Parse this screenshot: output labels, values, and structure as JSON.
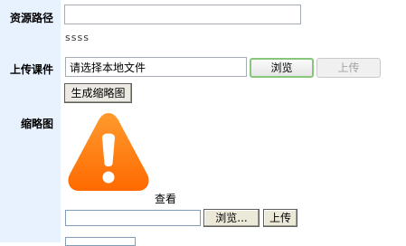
{
  "form": {
    "resource_path": {
      "label": "资源路径",
      "value": "",
      "hint": "ssss"
    },
    "upload_courseware": {
      "label": "上传课件",
      "file_value": "请选择本地文件",
      "browse_label": "浏览",
      "upload_label": "上传",
      "generate_thumbnail_label": "生成缩略图"
    },
    "thumbnail": {
      "label": "缩略图",
      "image_icon": "warning-icon",
      "view_label": "查看",
      "file_value": "",
      "browse_label": "浏览...",
      "upload_label": "上传"
    }
  },
  "colors": {
    "label_bg": "#e8f2fe",
    "warning_orange": "#ff7d00",
    "browse_border": "#86c77a"
  }
}
